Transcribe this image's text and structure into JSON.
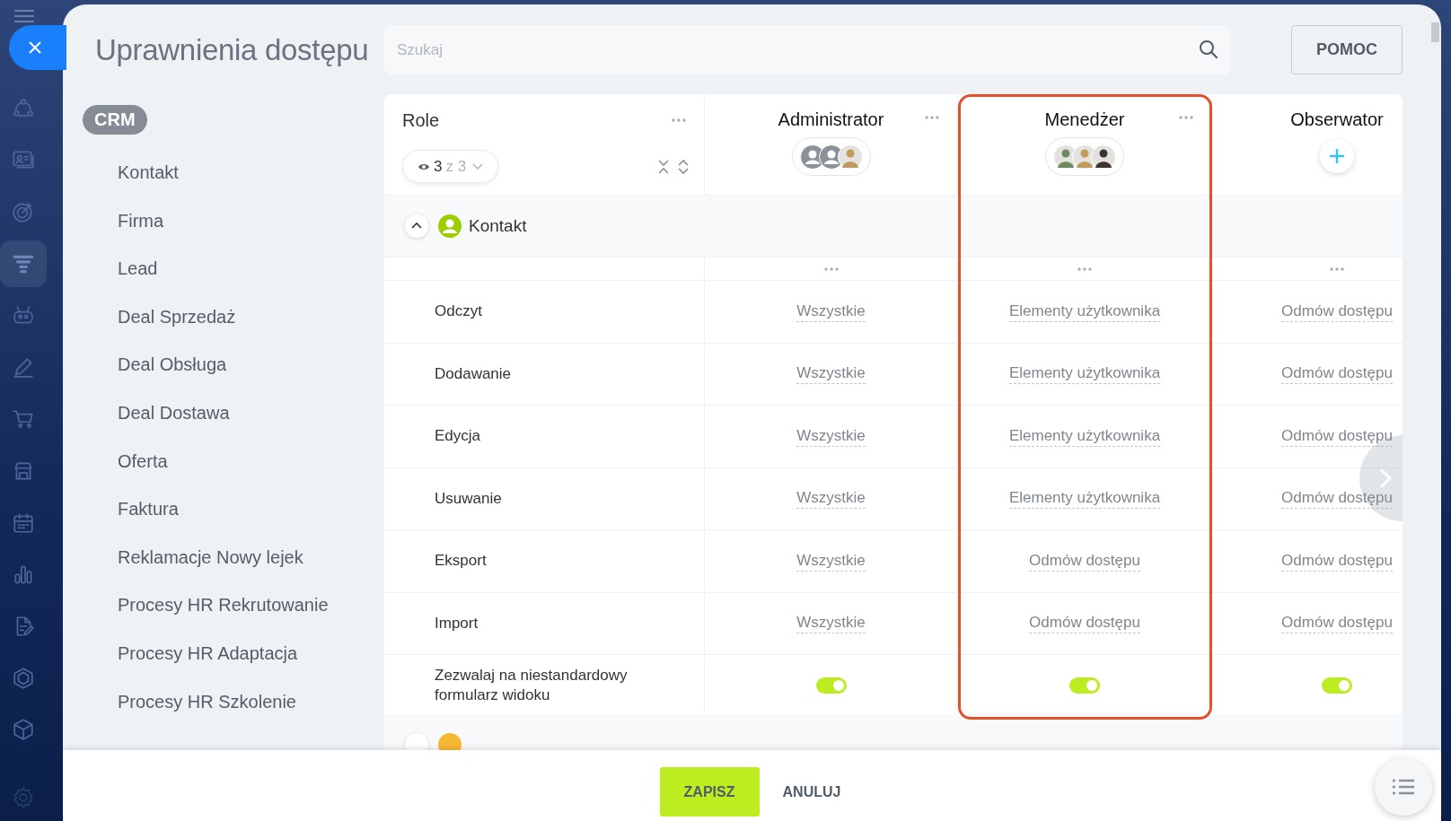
{
  "nav": {
    "items": [
      {
        "kind": "cycle",
        "selected": false
      },
      {
        "kind": "card",
        "selected": false
      },
      {
        "kind": "target",
        "selected": false
      },
      {
        "kind": "funnel",
        "selected": true
      },
      {
        "kind": "robot",
        "selected": false
      },
      {
        "kind": "pencil",
        "selected": false
      },
      {
        "kind": "cart",
        "selected": false
      },
      {
        "kind": "store",
        "selected": false
      },
      {
        "kind": "calendar",
        "selected": false
      },
      {
        "kind": "chart",
        "selected": false
      },
      {
        "kind": "document",
        "selected": false
      },
      {
        "kind": "hexagon",
        "selected": false
      },
      {
        "kind": "cube",
        "selected": false
      },
      {
        "kind": "gear",
        "selected": false
      }
    ]
  },
  "title": "Uprawnienia dostępu",
  "search": {
    "placeholder": "Szukaj"
  },
  "help_button": "POMOC",
  "sidebar": {
    "section": "CRM",
    "items": [
      "Kontakt",
      "Firma",
      "Lead",
      "Deal Sprzedaż",
      "Deal Obsługa",
      "Deal Dostawa",
      "Oferta",
      "Faktura",
      "Reklamacje Nowy lejek",
      "Procesy HR Rekrutowanie",
      "Procesy HR Adaptacja",
      "Procesy HR Szkolenie"
    ]
  },
  "table": {
    "role_header": "Role",
    "visible_count": "3",
    "visible_total": "z 3",
    "columns": [
      {
        "name": "Administrator",
        "highlighted": false,
        "members": [
          {
            "kind": "placeholder"
          },
          {
            "kind": "placeholder"
          },
          {
            "kind": "photo"
          }
        ]
      },
      {
        "name": "Menedżer",
        "highlighted": true,
        "members": [
          {
            "kind": "photo"
          },
          {
            "kind": "photo"
          },
          {
            "kind": "photo"
          }
        ]
      },
      {
        "name": "Obserwator",
        "highlighted": false
      }
    ],
    "groups": [
      {
        "label": "Kontakt",
        "expanded": true,
        "rows": [
          {
            "label": "Odczyt",
            "kind": "select",
            "cells": [
              "Wszystkie",
              "Elementy użytkownika",
              "Odmów dostępu"
            ]
          },
          {
            "label": "Dodawanie",
            "kind": "select",
            "cells": [
              "Wszystkie",
              "Elementy użytkownika",
              "Odmów dostępu"
            ]
          },
          {
            "label": "Edycja",
            "kind": "select",
            "cells": [
              "Wszystkie",
              "Elementy użytkownika",
              "Odmów dostępu"
            ]
          },
          {
            "label": "Usuwanie",
            "kind": "select",
            "cells": [
              "Wszystkie",
              "Elementy użytkownika",
              "Odmów dostępu"
            ]
          },
          {
            "label": "Eksport",
            "kind": "select",
            "cells": [
              "Wszystkie",
              "Odmów dostępu",
              "Odmów dostępu"
            ]
          },
          {
            "label": "Import",
            "kind": "select",
            "cells": [
              "Wszystkie",
              "Odmów dostępu",
              "Odmów dostępu"
            ]
          },
          {
            "label": "Zezwalaj na niestandardowy formularz widoku",
            "kind": "toggle",
            "cells": [
              {
                "on": true
              },
              {
                "on": true
              },
              {
                "on": true
              }
            ]
          }
        ]
      }
    ]
  },
  "footer": {
    "save": "ZAPISZ",
    "cancel": "ANULUJ"
  }
}
